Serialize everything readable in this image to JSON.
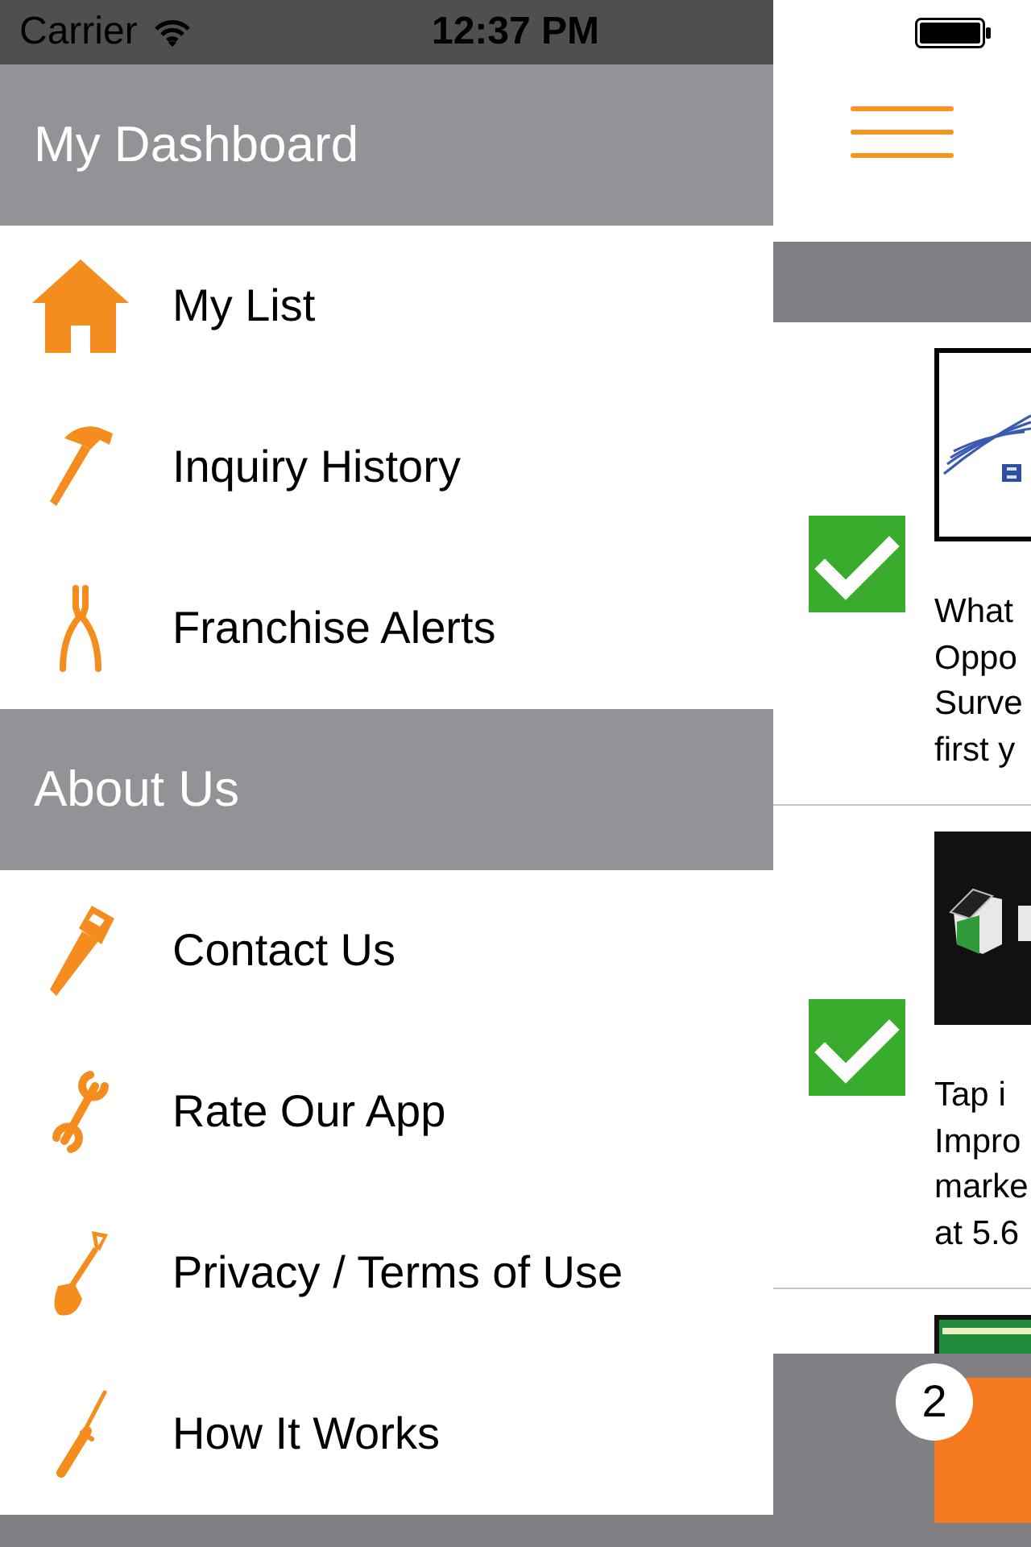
{
  "status_bar": {
    "carrier": "Carrier",
    "time": "12:37 PM"
  },
  "drawer": {
    "sections": [
      {
        "title": "My Dashboard",
        "items": [
          {
            "label": "My List"
          },
          {
            "label": "Inquiry History"
          },
          {
            "label": "Franchise Alerts"
          }
        ]
      },
      {
        "title": "About Us",
        "items": [
          {
            "label": "Contact Us"
          },
          {
            "label": "Rate Our App"
          },
          {
            "label": "Privacy / Terms of Use"
          },
          {
            "label": "How It Works"
          }
        ]
      }
    ]
  },
  "feed": {
    "items": [
      {
        "checked": true,
        "description_lines": [
          "What",
          "Oppo",
          "Surve",
          "first y"
        ]
      },
      {
        "checked": true,
        "description_lines": [
          "Tap i",
          "Impro",
          "marke",
          "at 5.6"
        ]
      }
    ]
  },
  "tab_bar": {
    "badge": "2"
  }
}
